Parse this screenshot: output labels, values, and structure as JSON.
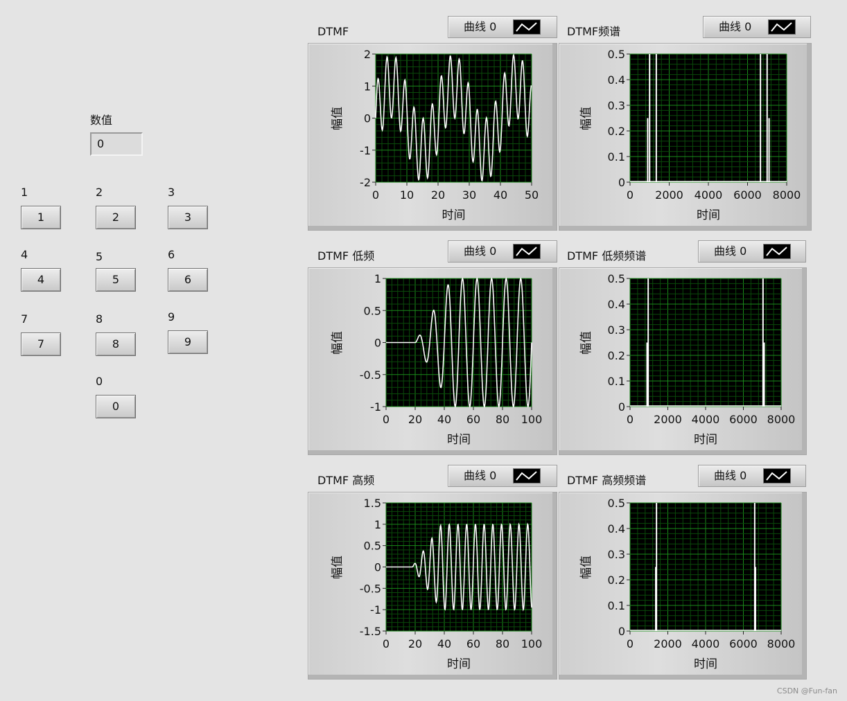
{
  "numeric": {
    "label": "数值",
    "value": "0"
  },
  "keypad": [
    {
      "label": "1",
      "text": "1"
    },
    {
      "label": "2",
      "text": "2"
    },
    {
      "label": "3",
      "text": "3"
    },
    {
      "label": "4",
      "text": "4"
    },
    {
      "label": "5",
      "text": "5"
    },
    {
      "label": "6",
      "text": "6"
    },
    {
      "label": "7",
      "text": "7"
    },
    {
      "label": "8",
      "text": "8"
    },
    {
      "label": "9",
      "text": "9"
    },
    {
      "label": "0",
      "text": "0"
    }
  ],
  "graphs": [
    {
      "title": "DTMF",
      "legend": "曲线 0",
      "ylabel": "幅值",
      "xlabel": "时间"
    },
    {
      "title": "DTMF频谱",
      "legend": "曲线 0",
      "ylabel": "幅值",
      "xlabel": "时间"
    },
    {
      "title": "DTMF 低频",
      "legend": "曲线 0",
      "ylabel": "幅值",
      "xlabel": "时间"
    },
    {
      "title": "DTMF 低频频谱",
      "legend": "曲线 0",
      "ylabel": "幅值",
      "xlabel": "时间"
    },
    {
      "title": "DTMF 高频",
      "legend": "曲线 0",
      "ylabel": "幅值",
      "xlabel": "时间"
    },
    {
      "title": "DTMF 高频频谱",
      "legend": "曲线 0",
      "ylabel": "幅值",
      "xlabel": "时间"
    }
  ],
  "chart_data": [
    {
      "type": "line",
      "title": "DTMF",
      "xlabel": "时间",
      "ylabel": "幅值",
      "xlim": [
        0,
        50
      ],
      "ylim": [
        -2,
        2
      ],
      "xticks": [
        "0",
        "10",
        "20",
        "30",
        "40",
        "50"
      ],
      "yticks": [
        "2",
        "1",
        "0",
        "-1",
        "-2"
      ],
      "series": [
        {
          "freqs": [
            0.05,
            0.345
          ],
          "amps": [
            1,
            1
          ],
          "ramp_start": 0,
          "ramp_end": 0,
          "n": 50
        }
      ]
    },
    {
      "type": "line",
      "title": "DTMF频谱",
      "xlabel": "时间",
      "ylabel": "幅值",
      "xlim": [
        0,
        8000
      ],
      "ylim": [
        0,
        0.5
      ],
      "xticks": [
        "0",
        "2000",
        "4000",
        "6000",
        "8000"
      ],
      "yticks": [
        "0.5",
        "0.4",
        "0.3",
        "0.2",
        "0.1",
        "0"
      ],
      "spikes": [
        [
          900,
          0.25
        ],
        [
          1000,
          0.5
        ],
        [
          1340,
          0.5
        ],
        [
          6660,
          0.5
        ],
        [
          7000,
          0.5
        ],
        [
          7100,
          0.25
        ]
      ]
    },
    {
      "type": "line",
      "title": "DTMF 低频",
      "xlabel": "时间",
      "ylabel": "幅值",
      "xlim": [
        0,
        100
      ],
      "ylim": [
        -1,
        1
      ],
      "xticks": [
        "0",
        "20",
        "40",
        "60",
        "80",
        "100"
      ],
      "yticks": [
        "1",
        "0.5",
        "0",
        "-0.5",
        "-1"
      ],
      "series": [
        {
          "freqs": [
            0.1
          ],
          "amps": [
            1
          ],
          "ramp_start": 20,
          "ramp_end": 45,
          "n": 100
        }
      ]
    },
    {
      "type": "line",
      "title": "DTMF 低频频谱",
      "xlabel": "时间",
      "ylabel": "幅值",
      "xlim": [
        0,
        8000
      ],
      "ylim": [
        0,
        0.5
      ],
      "xticks": [
        "0",
        "2000",
        "4000",
        "6000",
        "8000"
      ],
      "yticks": [
        "0.5",
        "0.4",
        "0.3",
        "0.2",
        "0.1",
        "0"
      ],
      "spikes": [
        [
          900,
          0.25
        ],
        [
          960,
          0.5
        ],
        [
          7040,
          0.5
        ],
        [
          7100,
          0.25
        ]
      ]
    },
    {
      "type": "line",
      "title": "DTMF 高频",
      "xlabel": "时间",
      "ylabel": "幅值",
      "xlim": [
        0,
        100
      ],
      "ylim": [
        -1.5,
        1.5
      ],
      "xticks": [
        "0",
        "20",
        "40",
        "60",
        "80",
        "100"
      ],
      "yticks": [
        "1.5",
        "1",
        "0.5",
        "0",
        "-0.5",
        "-1",
        "-1.5"
      ],
      "series": [
        {
          "freqs": [
            0.167
          ],
          "amps": [
            1
          ],
          "ramp_start": 18,
          "ramp_end": 38,
          "n": 100
        }
      ]
    },
    {
      "type": "line",
      "title": "DTMF 高频频谱",
      "xlabel": "时间",
      "ylabel": "幅值",
      "xlim": [
        0,
        8000
      ],
      "ylim": [
        0,
        0.5
      ],
      "xticks": [
        "0",
        "2000",
        "4000",
        "6000",
        "8000"
      ],
      "yticks": [
        "0.5",
        "0.4",
        "0.3",
        "0.2",
        "0.1",
        "0"
      ],
      "spikes": [
        [
          1360,
          0.25
        ],
        [
          1400,
          0.5
        ],
        [
          6600,
          0.5
        ],
        [
          6640,
          0.25
        ]
      ]
    }
  ],
  "watermark": "CSDN @Fun-fan"
}
